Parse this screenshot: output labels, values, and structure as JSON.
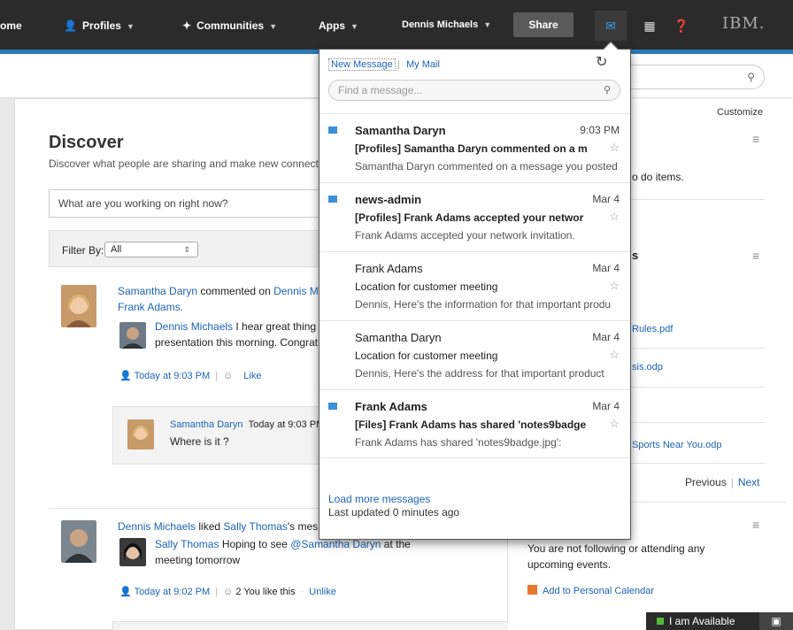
{
  "nav": {
    "home": "ome",
    "profiles": "Profiles",
    "communities": "Communities",
    "apps": "Apps",
    "user": "Dennis Michaels",
    "share": "Share",
    "logo": "IBM."
  },
  "main": {
    "title": "Discover",
    "subtitle": "Discover what people are sharing and make new connecti",
    "status_placeholder": "What are you working on right now?",
    "filter_label": "Filter By:",
    "filter_value": "All"
  },
  "feed": [
    {
      "actor": "Samantha Daryn",
      "action": " commented on ",
      "target": "Dennis M",
      "target2": "Frank Adams.",
      "quote_author": "Dennis Michaels",
      "quote_text1": " I hear great thing",
      "quote_text2": "presentation this morning. Congrat",
      "time": "Today at 9:03 PM",
      "like": "Like",
      "comment": {
        "author": "Samantha Daryn",
        "time": "Today at 9:03 PM",
        "text": "Where is it ?"
      }
    },
    {
      "actor": "Dennis Michaels",
      "action": " liked ",
      "target": "Sally Thomas",
      "target_suffix": "'s mes",
      "quote_author": "Sally Thomas",
      "quote_text1": " Hoping to see ",
      "quote_mention": "@Samantha Daryn",
      "quote_text2": " at the",
      "quote_text3": "meeting tomorrow",
      "time": "Today at 9:02 PM",
      "like_count": "2",
      "like_text": "You like this",
      "unlike": "Unlike"
    }
  ],
  "right": {
    "customize": "Customize",
    "todo_text": "o do items.",
    "files_heading": "s",
    "files": [
      "Rules.pdf",
      "sis.odp",
      "Sports Near You.odp"
    ],
    "previous": "Previous",
    "next": "Next",
    "events_text1": "You are not following or attending any",
    "events_text2": "upcoming events.",
    "add_calendar": "Add to Personal Calendar"
  },
  "chat": {
    "status": "I am Available"
  },
  "mail": {
    "new_message": "New Message",
    "my_mail": "My Mail",
    "search_placeholder": "Find a message...",
    "items": [
      {
        "sender": "Samantha Daryn",
        "time": "9:03 PM",
        "subject": "[Profiles] Samantha Daryn commented on a m",
        "preview": "Samantha Daryn commented on a message you posted"
      },
      {
        "sender": "news-admin",
        "time": "Mar 4",
        "subject": "[Profiles] Frank Adams accepted your networ",
        "preview": "Frank Adams accepted your network invitation."
      },
      {
        "sender": "Frank Adams",
        "time": "Mar 4",
        "subject": "Location for customer meeting",
        "preview": "Dennis, Here's the information for that important produ"
      },
      {
        "sender": "Samantha Daryn",
        "time": "Mar 4",
        "subject": "Location for customer meeting",
        "preview": "Dennis, Here's the address for that important product"
      },
      {
        "sender": "Frank Adams",
        "time": "Mar 4",
        "subject": "[Files] Frank Adams has shared 'notes9badge",
        "preview": "Frank Adams has shared 'notes9badge.jpg':"
      }
    ],
    "load_more": "Load more messages",
    "last_updated": "Last updated 0 minutes ago"
  }
}
